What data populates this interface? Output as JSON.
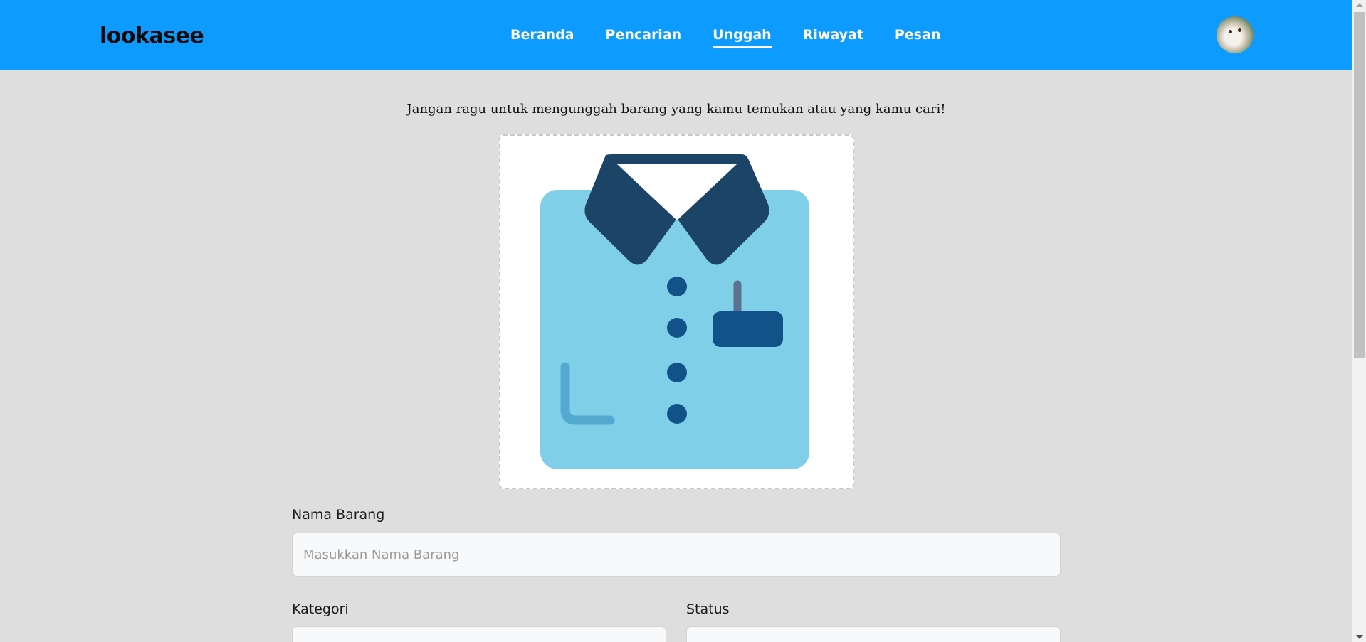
{
  "header": {
    "brand": "lookasee",
    "nav": [
      {
        "label": "Beranda"
      },
      {
        "label": "Pencarian"
      },
      {
        "label": "Unggah",
        "active": true
      },
      {
        "label": "Riwayat"
      },
      {
        "label": "Pesan"
      }
    ],
    "avatar_icon": "user-avatar-cat-photo"
  },
  "main": {
    "intro": "Jangan ragu untuk mengunggah barang yang kamu temukan atau yang kamu cari!",
    "upload_image_icon": "shirt-icon",
    "fields": {
      "nama_barang": {
        "label": "Nama Barang",
        "placeholder": "Masukkan Nama Barang",
        "value": ""
      },
      "kategori": {
        "label": "Kategori",
        "value": ""
      },
      "status": {
        "label": "Status",
        "value": ""
      }
    }
  },
  "colors": {
    "header_bg": "#0e9bff",
    "page_bg": "#dedede",
    "shirt_body": "#80cfe9",
    "shirt_collar": "#1b4466",
    "shirt_buttons": "#125288"
  }
}
